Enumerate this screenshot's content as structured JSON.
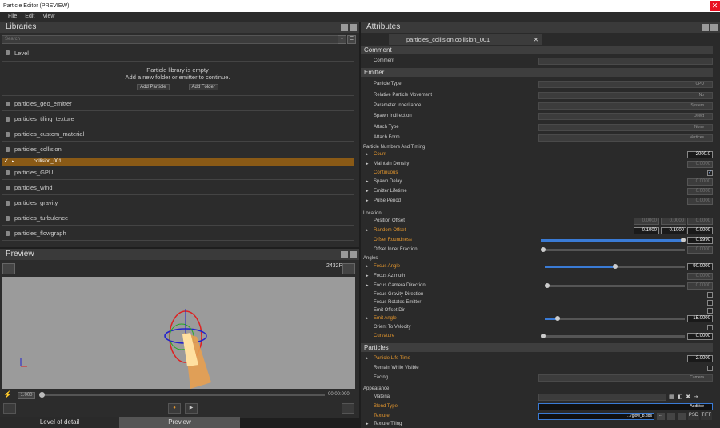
{
  "window": {
    "title": "Particle Editor (PREVIEW)",
    "close": "✕"
  },
  "menu": [
    "File",
    "Edit",
    "View"
  ],
  "libraries": {
    "title": "Libraries",
    "search_placeholder": "Search",
    "level": "Level",
    "empty_line1": "Particle library is empty",
    "empty_line2": "Add a new folder or emitter to continue.",
    "add_particle": "Add Particle",
    "add_folder": "Add Folder",
    "items": [
      "particles_geo_emitter",
      "particles_tiling_texture",
      "particles_custom_material",
      "particles_collision",
      "particles_GPU",
      "particles_wind",
      "particles_gravity",
      "particles_turbulence",
      "particles_flowgraph"
    ],
    "selected_child": "collision_001"
  },
  "preview": {
    "title": "Preview",
    "count": "2432P",
    "speed": "1.000",
    "time": "00:00:000"
  },
  "tabs": [
    "Level of detail",
    "Preview"
  ],
  "attributes": {
    "title": "Attributes",
    "doc_tab": "particles_collision.collision_001",
    "sections": {
      "comment": "Comment",
      "emitter": "Emitter",
      "particles": "Particles"
    },
    "comment_label": "Comment",
    "emitter_rows": [
      {
        "label": "Particle Type",
        "value": "CPU"
      },
      {
        "label": "Relative Particle Movement",
        "value": "No"
      },
      {
        "label": "Parameter Inheritance",
        "value": "System"
      },
      {
        "label": "Spawn Indirection",
        "value": "Direct"
      },
      {
        "label": "Attach Type",
        "value": "None"
      },
      {
        "label": "Attach Form",
        "value": "Vertices"
      }
    ],
    "timing_header": "Particle Numbers And Timing",
    "timing": {
      "count": "Count",
      "count_val": "2000.0",
      "maintain": "Maintain Density",
      "maintain_val": "0.0000",
      "continuous": "Continuous",
      "spawn_delay": "Spawn Delay",
      "spawn_val": "0.0000",
      "lifetime": "Emitter Lifetime",
      "lifetime_val": "0.0000",
      "pulse": "Pulse Period",
      "pulse_val": "0.0000"
    },
    "location_header": "Location",
    "location": {
      "pos_offset": "Position Offset",
      "rand_offset": "Random Offset",
      "offset_round": "Offset Roundness",
      "inner_frac": "Offset Inner Fraction",
      "zero": "0.0000",
      "rand_x": "0.1000",
      "rand_y": "0.1000",
      "rand_z": "0.0000",
      "round_val": "0.9990"
    },
    "angles_header": "Angles",
    "angles": {
      "focus_angle": "Focus Angle",
      "focus_val": "90.0000",
      "azimuth": "Focus Azimuth",
      "azimuth_val": "0.0000",
      "cam_dir": "Focus Camera Direction",
      "cam_val": "0.0000",
      "grav_dir": "Focus Gravity Direction",
      "rot_emit": "Focus Rotates Emitter",
      "emit_off": "Emit Offset Dir",
      "emit_angle": "Emit Angle",
      "emit_val": "15.0000",
      "orient": "Orient To Velocity",
      "curvature": "Curvature",
      "curv_val": "0.0000"
    },
    "particles": {
      "life": "Particle Life Time",
      "life_val": "2.0000",
      "remain": "Remain While Visible",
      "facing": "Facing",
      "facing_val": "Camera"
    },
    "appearance_header": "Appearance",
    "appearance": {
      "material": "Material",
      "blend": "Blend Type",
      "blend_val": "Additive",
      "texture": "Texture",
      "texture_val": ".../glow_b.dds",
      "tiling": "Texture Tiling",
      "psd": "PSD",
      "tiff": "TIFF"
    }
  }
}
